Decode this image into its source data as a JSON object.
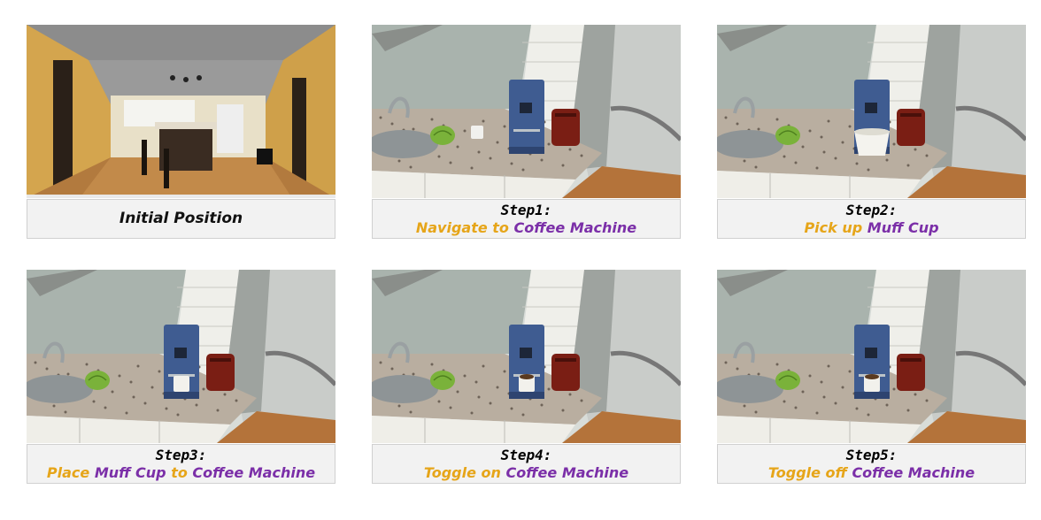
{
  "palette": {
    "verb": "#e6a519",
    "object": "#7b2fa8"
  },
  "panels": [
    {
      "caption": "Initial Position"
    },
    {
      "step": "Step1:",
      "parts": [
        {
          "text": "Navigate to",
          "kind": "verb"
        },
        {
          "text": "Coffee Machine",
          "kind": "obj"
        }
      ]
    },
    {
      "step": "Step2:",
      "parts": [
        {
          "text": "Pick up",
          "kind": "verb"
        },
        {
          "text": "Muff Cup",
          "kind": "obj"
        }
      ]
    },
    {
      "step": "Step3:",
      "parts": [
        {
          "text": "Place",
          "kind": "verb"
        },
        {
          "text": "Muff Cup",
          "kind": "obj"
        },
        {
          "text": "to",
          "kind": "verb"
        },
        {
          "text": "Coffee Machine",
          "kind": "obj"
        }
      ]
    },
    {
      "step": "Step4:",
      "parts": [
        {
          "text": "Toggle on",
          "kind": "verb"
        },
        {
          "text": "Coffee Machine",
          "kind": "obj"
        }
      ]
    },
    {
      "step": "Step5:",
      "parts": [
        {
          "text": "Toggle off",
          "kind": "verb"
        },
        {
          "text": "Coffee Machine",
          "kind": "obj"
        }
      ]
    }
  ]
}
